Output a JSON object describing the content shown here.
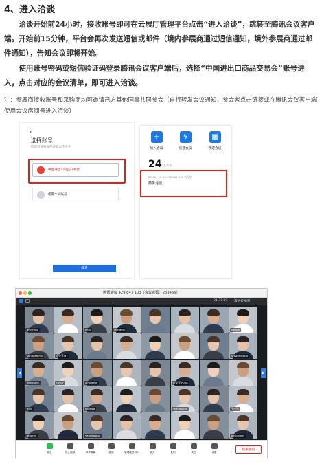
{
  "section": {
    "heading": "4、进入洽谈",
    "para1": "洽谈开始前24小时，接收账号即可在云展厅管理平台点击“进入洽谈”，跳转至腾讯会议客户端。开始前15分钟，平台会再次发送短信或邮件（境内参展商通过短信通知，境外参展商通过邮件通知），告知会议即将开始。",
    "para2": "使用账号密码或短信验证码登录腾讯会议客户端后，选择“中国进出口商品交易会”账号进入，点击对应的会议清单，即可进入洽谈。",
    "note": "注：参展商接收账号和采购商均可邀请己方其他同事共同参会（自行转发会议通知，参会者点击链接或在腾讯会议客户端使用会议房间号进入洽谈）"
  },
  "screenshot1": {
    "back": "‹",
    "select_title": "选择账号",
    "select_sub": "检测到该账号已关联以下企业",
    "account1": "中国进出口商品交易会",
    "account2": "使用个人账号",
    "confirm": "确定",
    "quick_actions": [
      "加入会议",
      "快速会议",
      "预定会议"
    ],
    "date_num": "24",
    "date_sub": "8月 今天",
    "meeting_time": "20:00 - 20:30  378 885 431  待开始",
    "meeting_name": "商务洽谈"
  },
  "screenshot2": {
    "window_title": "腾讯会议 429 847 103（会议密码：233456）",
    "timer": "01:31:01",
    "view_label": "演讲者视图",
    "participants": [
      "amyfeng",
      "",
      "hajjj",
      "jamiecai",
      "",
      "",
      "",
      "baobei",
      "songgaomei",
      "会议室有?",
      "",
      "",
      "",
      "",
      "",
      "actwordkong",
      "penguinil",
      "luiyily",
      "lambertin",
      "",
      "",
      "会议室 P058",
      "",
      "",
      "fiolu",
      "",
      "sensika",
      "",
      "",
      "charleslong",
      "",
      "王一人",
      "gloorer",
      "",
      "yangkwang",
      "",
      "",
      "",
      "",
      "basicomer"
    ],
    "toolbar": [
      "静音",
      "停止视频",
      "共享屏幕",
      "邀请",
      "管理成员(36)",
      "聊天",
      "录制",
      "文档",
      "设置"
    ],
    "end_button": "结束会议"
  },
  "colors": {
    "alert_red": "#e0201a",
    "tencent_blue": "#1f7ae0"
  }
}
